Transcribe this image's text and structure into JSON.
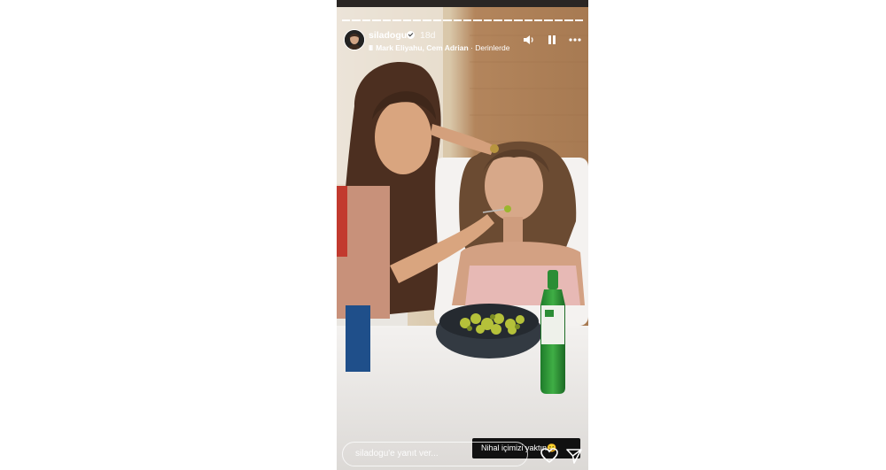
{
  "story": {
    "username": "siladogu",
    "age": "18d",
    "music_artists": "Mark Eliyahu, Cem Adrian",
    "music_separator": " · ",
    "music_track": "Derinlerde",
    "progress_segments": 24,
    "progress_completed": 24
  },
  "controls": {
    "sound_icon": "speaker-icon",
    "pause_icon": "pause-icon",
    "more_icon": "more-options-icon"
  },
  "footer": {
    "reply_placeholder": "siladogu'e yanıt ver...",
    "sticker_text": "Nihal içimizi yaktın😄"
  }
}
